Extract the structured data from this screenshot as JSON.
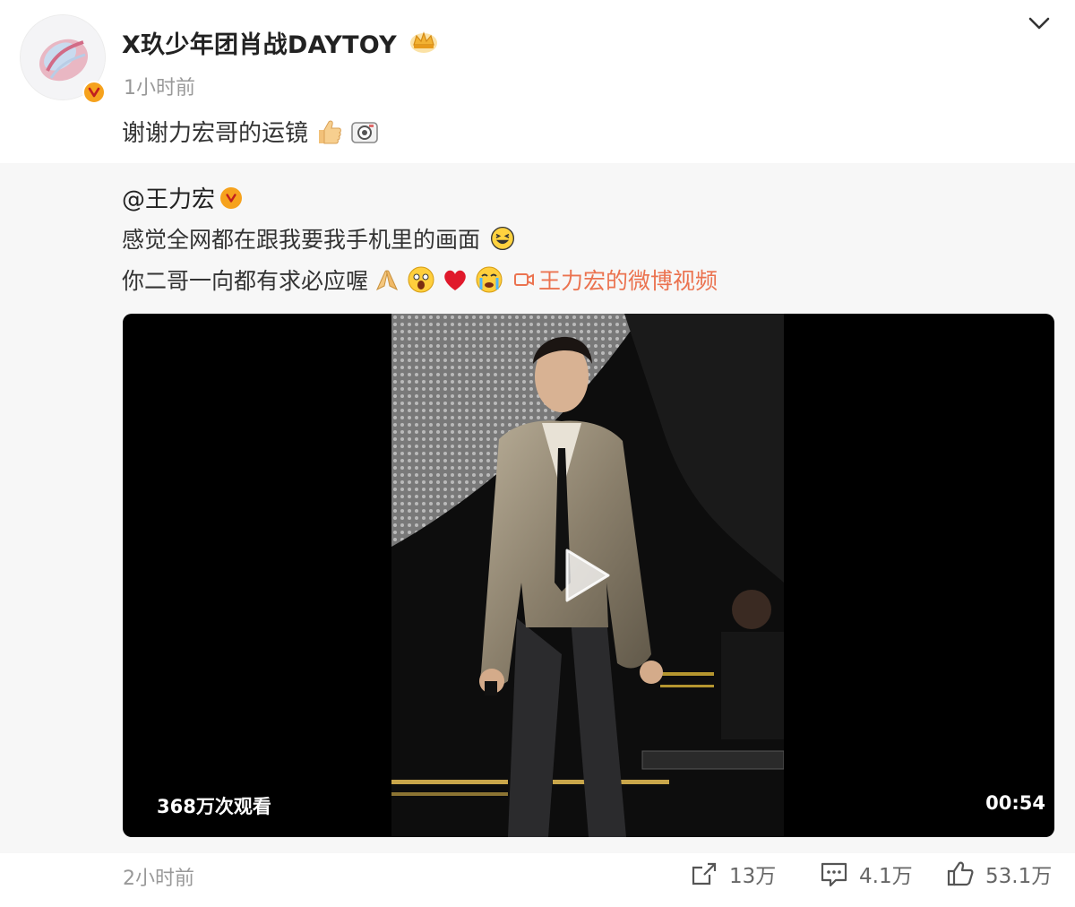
{
  "post": {
    "username": "X玖少年团肖战DAYTOY",
    "time": "1小时前",
    "text": "谢谢力宏哥的运镜"
  },
  "repost": {
    "user": "@王力宏",
    "line1": "感觉全网都在跟我要我手机里的画面",
    "line2": "你二哥一向都有求必应喔",
    "video_link": "王力宏的微博视频",
    "video": {
      "views": "368万次观看",
      "duration": "00:54"
    }
  },
  "footer": {
    "time": "2小时前",
    "reposts": "13万",
    "comments": "4.1万",
    "likes": "53.1万"
  },
  "colors": {
    "accent": "#eb7350",
    "verified": "#f6a21d",
    "repost_bg": "#f7f7f7"
  },
  "icons": [
    "verified-icon",
    "crown-icon",
    "chevron-down-icon",
    "thumbs-up-emoji",
    "camera-emoji",
    "laughing-emoji",
    "pray-emoji",
    "shocked-emoji",
    "heart-emoji",
    "crying-emoji",
    "video-icon",
    "play-icon",
    "repost-icon",
    "comment-icon",
    "like-icon"
  ]
}
